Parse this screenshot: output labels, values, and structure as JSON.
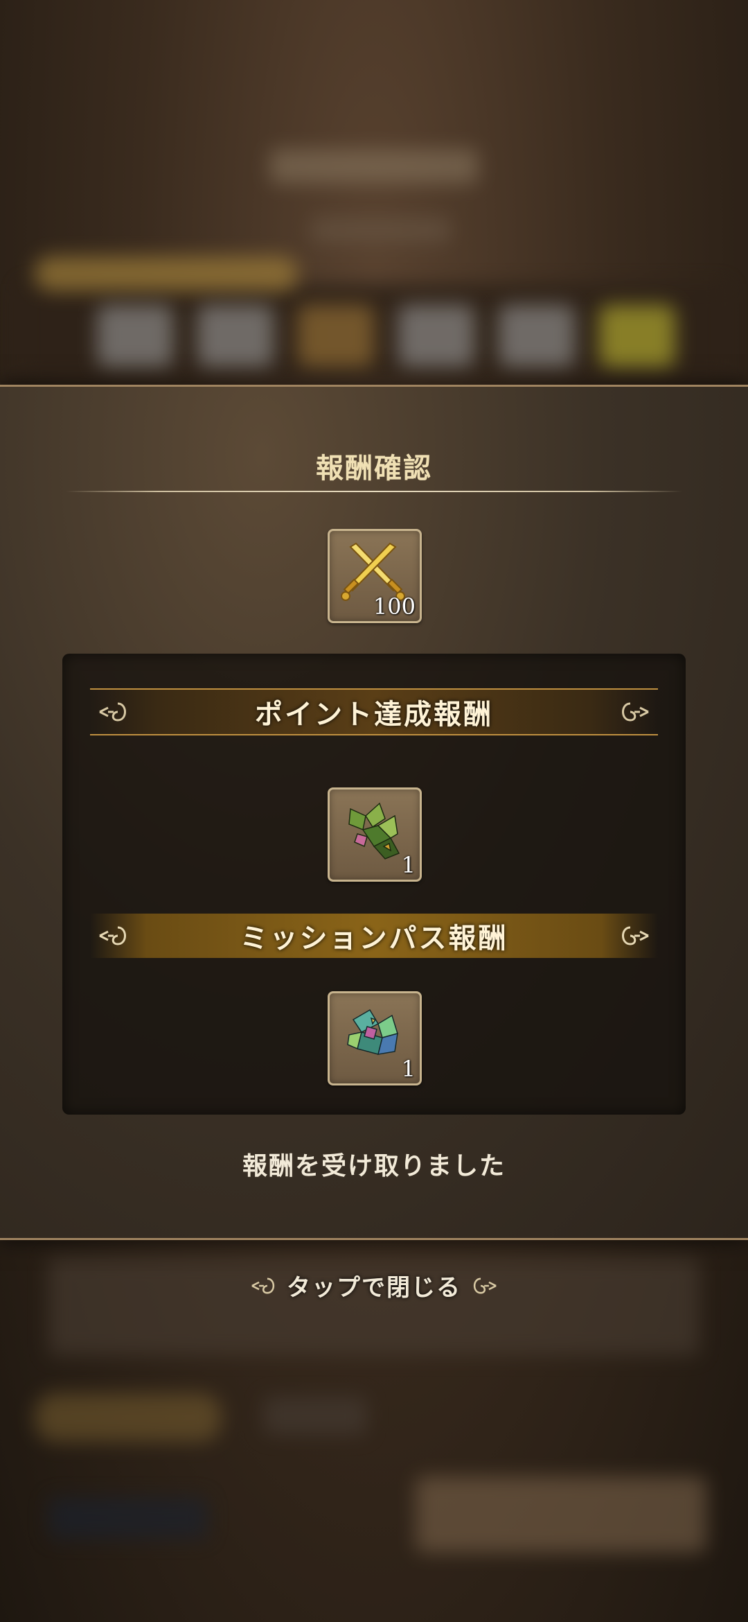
{
  "modal": {
    "title": "報酬確認",
    "top_reward": {
      "icon": "crossed-swords-icon",
      "quantity": "100"
    },
    "sections": [
      {
        "label": "ポイント達成報酬",
        "reward": {
          "icon": "green-crystal-icon",
          "quantity": "1"
        }
      },
      {
        "label": "ミッションパス報酬",
        "reward": {
          "icon": "iridescent-crystal-icon",
          "quantity": "1"
        }
      }
    ],
    "status_message": "報酬を受け取りました"
  },
  "close_hint": "タップで閉じる",
  "colors": {
    "accent_gold": "#c09040",
    "frame": "#a08460",
    "text": "#f2ead8"
  }
}
